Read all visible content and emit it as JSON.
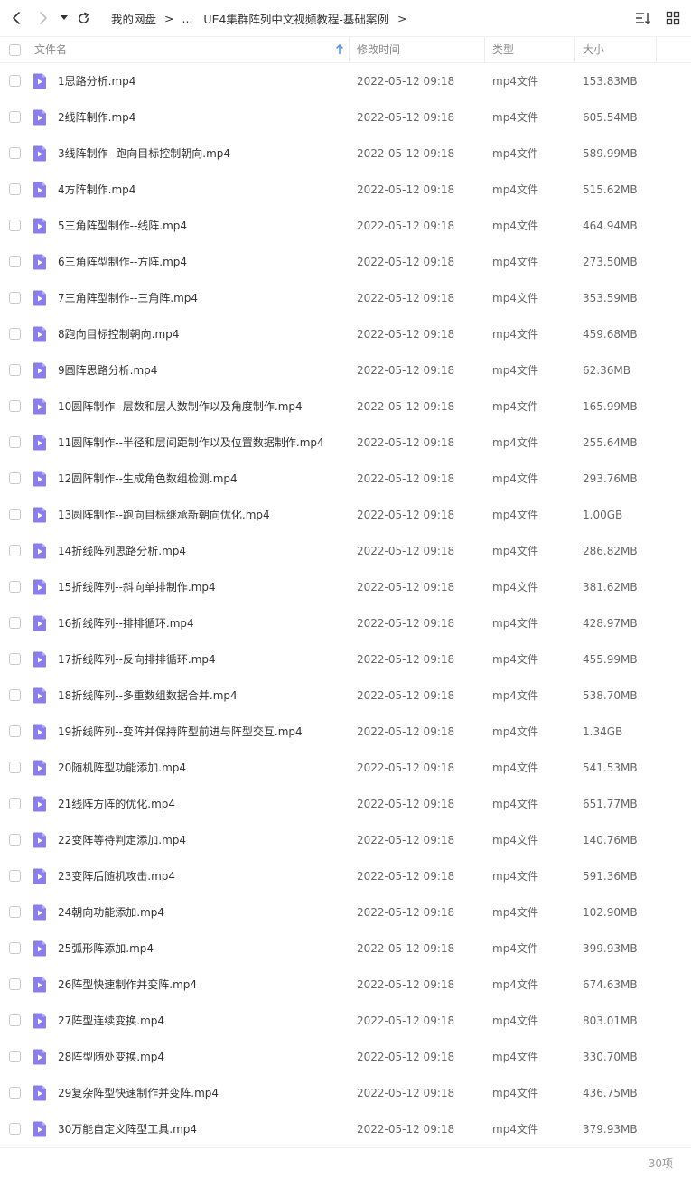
{
  "toolbar": {
    "back_icon": "chevron-left-icon",
    "forward_icon": "chevron-right-icon",
    "dropdown_icon": "caret-down-icon",
    "refresh_icon": "refresh-icon",
    "sort_icon": "sort-list-icon",
    "view_icon": "grid-view-icon"
  },
  "breadcrumb": {
    "root": "我的网盘",
    "ellipsis": "...",
    "current": "UE4集群阵列中文视频教程-基础案例",
    "separator": ">"
  },
  "columns": {
    "name": "文件名",
    "mtime": "修改时间",
    "type": "类型",
    "size": "大小"
  },
  "colors": {
    "file_icon": "#8a7ee8",
    "sort_arrow": "#4a90e2"
  },
  "files": [
    {
      "name": "1思路分析.mp4",
      "mtime": "2022-05-12 09:18",
      "type": "mp4文件",
      "size": "153.83MB"
    },
    {
      "name": "2线阵制作.mp4",
      "mtime": "2022-05-12 09:18",
      "type": "mp4文件",
      "size": "605.54MB"
    },
    {
      "name": "3线阵制作--跑向目标控制朝向.mp4",
      "mtime": "2022-05-12 09:18",
      "type": "mp4文件",
      "size": "589.99MB"
    },
    {
      "name": "4方阵制作.mp4",
      "mtime": "2022-05-12 09:18",
      "type": "mp4文件",
      "size": "515.62MB"
    },
    {
      "name": "5三角阵型制作--线阵.mp4",
      "mtime": "2022-05-12 09:18",
      "type": "mp4文件",
      "size": "464.94MB"
    },
    {
      "name": "6三角阵型制作--方阵.mp4",
      "mtime": "2022-05-12 09:18",
      "type": "mp4文件",
      "size": "273.50MB"
    },
    {
      "name": "7三角阵型制作--三角阵.mp4",
      "mtime": "2022-05-12 09:18",
      "type": "mp4文件",
      "size": "353.59MB"
    },
    {
      "name": "8跑向目标控制朝向.mp4",
      "mtime": "2022-05-12 09:18",
      "type": "mp4文件",
      "size": "459.68MB"
    },
    {
      "name": "9圆阵思路分析.mp4",
      "mtime": "2022-05-12 09:18",
      "type": "mp4文件",
      "size": "62.36MB"
    },
    {
      "name": "10圆阵制作--层数和层人数制作以及角度制作.mp4",
      "mtime": "2022-05-12 09:18",
      "type": "mp4文件",
      "size": "165.99MB"
    },
    {
      "name": "11圆阵制作--半径和层间距制作以及位置数据制作.mp4",
      "mtime": "2022-05-12 09:18",
      "type": "mp4文件",
      "size": "255.64MB"
    },
    {
      "name": "12圆阵制作--生成角色数组检测.mp4",
      "mtime": "2022-05-12 09:18",
      "type": "mp4文件",
      "size": "293.76MB"
    },
    {
      "name": "13圆阵制作--跑向目标继承新朝向优化.mp4",
      "mtime": "2022-05-12 09:18",
      "type": "mp4文件",
      "size": "1.00GB"
    },
    {
      "name": "14折线阵列思路分析.mp4",
      "mtime": "2022-05-12 09:18",
      "type": "mp4文件",
      "size": "286.82MB"
    },
    {
      "name": "15折线阵列--斜向单排制作.mp4",
      "mtime": "2022-05-12 09:18",
      "type": "mp4文件",
      "size": "381.62MB"
    },
    {
      "name": "16折线阵列--排排循环.mp4",
      "mtime": "2022-05-12 09:18",
      "type": "mp4文件",
      "size": "428.97MB"
    },
    {
      "name": "17折线阵列--反向排排循环.mp4",
      "mtime": "2022-05-12 09:18",
      "type": "mp4文件",
      "size": "455.99MB"
    },
    {
      "name": "18折线阵列--多重数组数据合并.mp4",
      "mtime": "2022-05-12 09:18",
      "type": "mp4文件",
      "size": "538.70MB"
    },
    {
      "name": "19折线阵列--变阵并保持阵型前进与阵型交互.mp4",
      "mtime": "2022-05-12 09:18",
      "type": "mp4文件",
      "size": "1.34GB"
    },
    {
      "name": "20随机阵型功能添加.mp4",
      "mtime": "2022-05-12 09:18",
      "type": "mp4文件",
      "size": "541.53MB"
    },
    {
      "name": "21线阵方阵的优化.mp4",
      "mtime": "2022-05-12 09:18",
      "type": "mp4文件",
      "size": "651.77MB"
    },
    {
      "name": "22变阵等待判定添加.mp4",
      "mtime": "2022-05-12 09:18",
      "type": "mp4文件",
      "size": "140.76MB"
    },
    {
      "name": "23变阵后随机攻击.mp4",
      "mtime": "2022-05-12 09:18",
      "type": "mp4文件",
      "size": "591.36MB"
    },
    {
      "name": "24朝向功能添加.mp4",
      "mtime": "2022-05-12 09:18",
      "type": "mp4文件",
      "size": "102.90MB"
    },
    {
      "name": "25弧形阵添加.mp4",
      "mtime": "2022-05-12 09:18",
      "type": "mp4文件",
      "size": "399.93MB"
    },
    {
      "name": "26阵型快速制作并变阵.mp4",
      "mtime": "2022-05-12 09:18",
      "type": "mp4文件",
      "size": "674.63MB"
    },
    {
      "name": "27阵型连续变换.mp4",
      "mtime": "2022-05-12 09:18",
      "type": "mp4文件",
      "size": "803.01MB"
    },
    {
      "name": "28阵型随处变换.mp4",
      "mtime": "2022-05-12 09:18",
      "type": "mp4文件",
      "size": "330.70MB"
    },
    {
      "name": "29复杂阵型快速制作并变阵.mp4",
      "mtime": "2022-05-12 09:18",
      "type": "mp4文件",
      "size": "436.75MB"
    },
    {
      "name": "30万能自定义阵型工具.mp4",
      "mtime": "2022-05-12 09:18",
      "type": "mp4文件",
      "size": "379.93MB"
    }
  ],
  "footer": {
    "count": "30项"
  }
}
